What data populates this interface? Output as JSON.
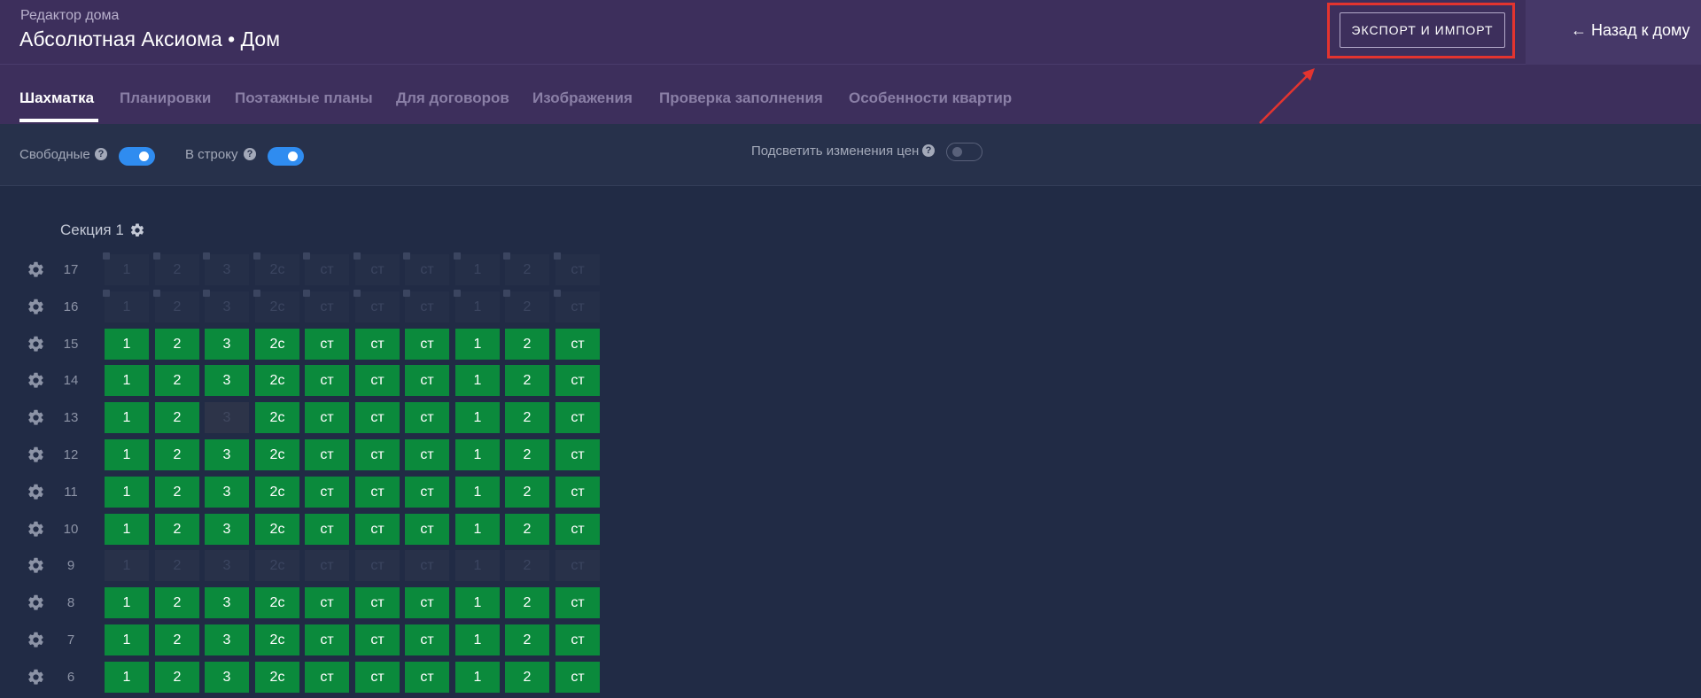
{
  "header": {
    "subtitle": "Редактор дома",
    "title": "Абсолютная Аксиома • Дом",
    "export_button": "ЭКСПОРТ И ИМПОРТ",
    "back_link": "← Назад к дому",
    "accent_color": "#e3342f"
  },
  "tabs": [
    {
      "label": "Шахматка",
      "active": true
    },
    {
      "label": "Планировки",
      "active": false
    },
    {
      "label": "Поэтажные планы",
      "active": false
    },
    {
      "label": "Для договоров",
      "active": false
    },
    {
      "label": "Изображения",
      "active": false
    },
    {
      "label": "Проверка заполнения",
      "active": false
    },
    {
      "label": "Особенности квартир",
      "active": false
    }
  ],
  "filters": {
    "free": {
      "label": "Свободные",
      "on": true
    },
    "inline": {
      "label": "В строку",
      "on": true
    },
    "highlight": {
      "label": "Подсветить изменения цен",
      "on": false
    }
  },
  "section": {
    "title": "Секция 1",
    "columns": [
      "1",
      "2",
      "3",
      "2с",
      "ст",
      "ст",
      "ст",
      "1",
      "2",
      "ст"
    ],
    "floors": [
      {
        "number": "17",
        "status": [
          "empty",
          "empty",
          "empty",
          "empty",
          "empty",
          "empty",
          "empty",
          "empty",
          "empty",
          "empty"
        ]
      },
      {
        "number": "16",
        "status": [
          "empty",
          "empty",
          "empty",
          "empty",
          "empty",
          "empty",
          "empty",
          "empty",
          "empty",
          "empty"
        ]
      },
      {
        "number": "15",
        "status": [
          "sold",
          "sold",
          "sold",
          "sold",
          "sold",
          "sold",
          "sold",
          "sold",
          "sold",
          "sold"
        ]
      },
      {
        "number": "14",
        "status": [
          "sold",
          "sold",
          "sold",
          "sold",
          "sold",
          "sold",
          "sold",
          "sold",
          "sold",
          "sold"
        ]
      },
      {
        "number": "13",
        "status": [
          "sold",
          "sold",
          "blank",
          "sold",
          "sold",
          "sold",
          "sold",
          "sold",
          "sold",
          "sold"
        ]
      },
      {
        "number": "12",
        "status": [
          "sold",
          "sold",
          "sold",
          "sold",
          "sold",
          "sold",
          "sold",
          "sold",
          "sold",
          "sold"
        ]
      },
      {
        "number": "11",
        "status": [
          "sold",
          "sold",
          "sold",
          "sold",
          "sold",
          "sold",
          "sold",
          "sold",
          "sold",
          "sold"
        ]
      },
      {
        "number": "10",
        "status": [
          "sold",
          "sold",
          "sold",
          "sold",
          "sold",
          "sold",
          "sold",
          "sold",
          "sold",
          "sold"
        ]
      },
      {
        "number": "9",
        "status": [
          "dim",
          "dim",
          "dim",
          "dim",
          "dim",
          "dim",
          "dim",
          "dim",
          "dim",
          "dim"
        ]
      },
      {
        "number": "8",
        "status": [
          "sold",
          "sold",
          "sold",
          "sold",
          "sold",
          "sold",
          "sold",
          "sold",
          "sold",
          "sold"
        ]
      },
      {
        "number": "7",
        "status": [
          "sold",
          "sold",
          "sold",
          "sold",
          "sold",
          "sold",
          "sold",
          "sold",
          "sold",
          "sold"
        ]
      },
      {
        "number": "6",
        "status": [
          "sold",
          "sold",
          "sold",
          "sold",
          "sold",
          "sold",
          "sold",
          "sold",
          "sold",
          "sold"
        ]
      }
    ]
  }
}
